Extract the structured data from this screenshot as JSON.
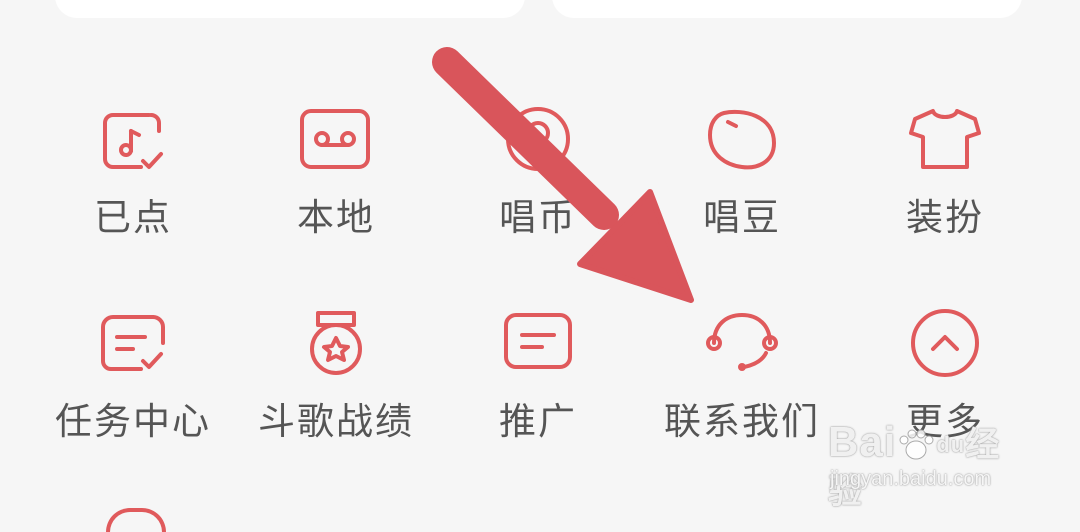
{
  "accent_color": "#e05a5c",
  "label_color": "#555555",
  "menu": {
    "row1": [
      {
        "label": "已点",
        "icon": "song-requested-icon"
      },
      {
        "label": "本地",
        "icon": "cassette-local-icon"
      },
      {
        "label": "唱币",
        "icon": "coin-icon"
      },
      {
        "label": "唱豆",
        "icon": "bean-icon"
      },
      {
        "label": "装扮",
        "icon": "tshirt-icon"
      }
    ],
    "row2": [
      {
        "label": "任务中心",
        "icon": "task-check-icon"
      },
      {
        "label": "斗歌战绩",
        "icon": "medal-icon"
      },
      {
        "label": "推广",
        "icon": "message-promo-icon"
      },
      {
        "label": "联系我们",
        "icon": "headset-icon"
      },
      {
        "label": "更多",
        "icon": "chevron-up-circle-icon"
      }
    ]
  },
  "watermark": {
    "brand_left": "Bai",
    "brand_mid": "du",
    "brand_right": "经验",
    "sub": "jingyan.baidu.com"
  }
}
